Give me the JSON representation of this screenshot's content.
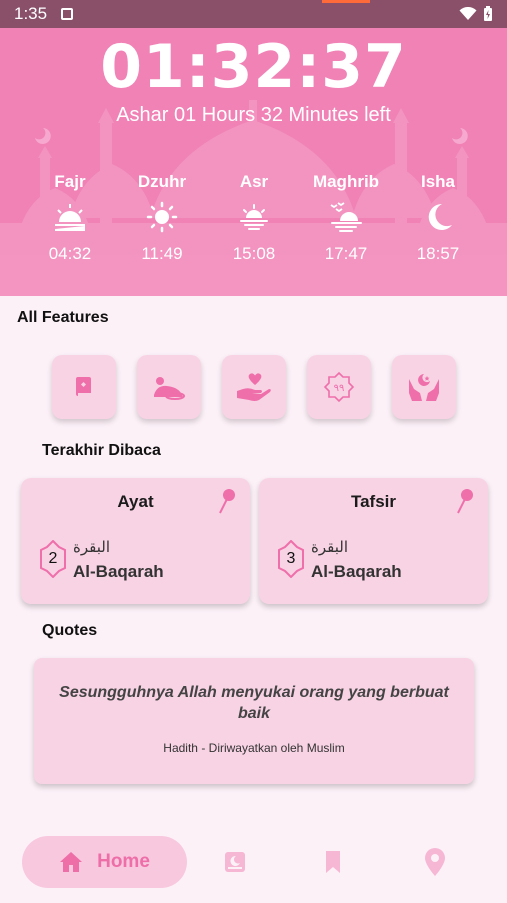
{
  "status": {
    "time": "1:35"
  },
  "header": {
    "clock": "01:32:37",
    "remaining": "Ashar 01 Hours 32 Minutes left",
    "prayers": [
      {
        "name": "Fajr",
        "time": "04:32",
        "icon": "sunrise-icon"
      },
      {
        "name": "Dzuhr",
        "time": "11:49",
        "icon": "sun-icon"
      },
      {
        "name": "Asr",
        "time": "15:08",
        "icon": "sunset-icon"
      },
      {
        "name": "Maghrib",
        "time": "17:47",
        "icon": "dusk-birds-icon"
      },
      {
        "name": "Isha",
        "time": "18:57",
        "icon": "crescent-moon-icon"
      }
    ]
  },
  "features": {
    "title": "All Features",
    "items": [
      "quran-book-icon",
      "prayer-person-icon",
      "charity-hand-heart-icon",
      "asmaul-husna-99-icon",
      "dua-hands-icon"
    ]
  },
  "last_read": {
    "title": "Terakhir Dibaca",
    "cards": [
      {
        "title": "Ayat",
        "number": "2",
        "arabic": "البقرة",
        "surah": "Al-Baqarah"
      },
      {
        "title": "Tafsir",
        "number": "3",
        "arabic": "البقرة",
        "surah": "Al-Baqarah"
      }
    ]
  },
  "quotes": {
    "title": "Quotes",
    "text": "Sesungguhnya Allah menyukai orang yang berbuat baik",
    "source": "Hadith - Diriwayatkan oleh Muslim"
  },
  "nav": {
    "home_label": "Home",
    "items": [
      "quran-icon",
      "bookmark-icon",
      "location-pin-icon"
    ]
  },
  "colors": {
    "accent": "#f082b6",
    "card": "#f8d3e4",
    "background": "#fdf1f8",
    "nav_active": "#ee6ea8"
  }
}
